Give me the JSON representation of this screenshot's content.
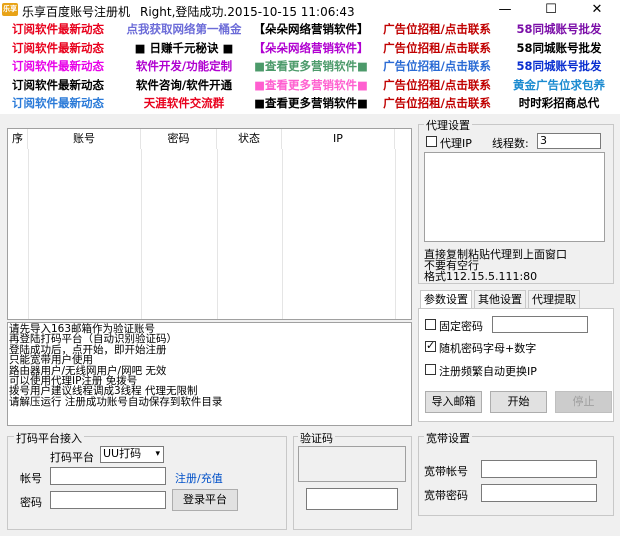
{
  "window": {
    "title": "乐享百度账号注册机",
    "status": "Right,登陆成功.2015-10-15 11:06:43",
    "icon_label": "乐享",
    "minimize": "—",
    "maximize": "☐",
    "close": "✕"
  },
  "ads": [
    {
      "text": "订阅软件最新动态",
      "color": "#e8001c"
    },
    {
      "text": "点我获取网络第一桶金",
      "color": "#6c6cd8"
    },
    {
      "text": "【朵朵网络营销软件】",
      "color": "#000000"
    },
    {
      "text": "广告位招租/点击联系",
      "color": "#c00000"
    },
    {
      "text": "58同城账号批发",
      "color": "#7b0fa8"
    },
    {
      "text": "订阅软件最新动态",
      "color": "#e8001c"
    },
    {
      "text": "■ 日赚千元秘诀 ■",
      "color": "#000000"
    },
    {
      "text": "【朵朵网络营销软件】",
      "color": "#b000d0"
    },
    {
      "text": "广告位招租/点击联系",
      "color": "#c00000"
    },
    {
      "text": "58同城账号批发",
      "color": "#000000"
    },
    {
      "text": "订阅软件最新动态",
      "color": "#e800e8"
    },
    {
      "text": "软件开发/功能定制",
      "color": "#b000d0"
    },
    {
      "text": "■查看更多营销软件■",
      "color": "#4c9a6a"
    },
    {
      "text": "广告位招租/点击联系",
      "color": "#2a6ad4"
    },
    {
      "text": "58同城账号批发",
      "color": "#0a2fd0"
    },
    {
      "text": "订阅软件最新动态",
      "color": "#000000"
    },
    {
      "text": "软件咨询/软件开通",
      "color": "#000000"
    },
    {
      "text": "■查看更多营销软件■",
      "color": "#ff5fd0"
    },
    {
      "text": "广告位招租/点击联系",
      "color": "#c00000"
    },
    {
      "text": "黄金广告位求包养",
      "color": "#1a8ad0"
    },
    {
      "text": "订阅软件最新动态",
      "color": "#2a7ad8"
    },
    {
      "text": "天涯软件交流群",
      "color": "#e8001c"
    },
    {
      "text": "■查看更多营销软件■",
      "color": "#000000"
    },
    {
      "text": "广告位招租/点击联系",
      "color": "#c00000"
    },
    {
      "text": "时时彩招商总代",
      "color": "#000000"
    }
  ],
  "table": {
    "headers": [
      "序",
      "账号",
      "密码",
      "状态",
      "IP"
    ]
  },
  "log_lines": [
    "请先导入163邮箱作为验证账号",
    "再登陆打码平台（自动识别验证码）",
    "登陆成功后，点开始，即开始注册",
    "只能宽带用户使用",
    "路由器用户/无线网用户/网吧 无效",
    "可以使用代理IP注册 免拨号",
    "拨号用户建议线程调成3线程 代理无限制",
    "请解压运行 注册成功账号自动保存到软件目录"
  ],
  "proxy": {
    "group_label": "代理设置",
    "use_proxy_label": "代理IP",
    "use_proxy_checked": false,
    "threads_label": "线程数:",
    "threads_value": "3",
    "hint1": "直接复制粘贴代理到上面窗口",
    "hint2": "不要有空行",
    "hint3": "格式112.15.5.111:80"
  },
  "tabs": [
    "参数设置",
    "其他设置",
    "代理提取"
  ],
  "params": {
    "fixed_pwd_label": "固定密码",
    "fixed_pwd_checked": false,
    "random_pwd_label": "随机密码字母+数字",
    "random_pwd_checked": true,
    "auto_change_ip_label": "注册频繁自动更换IP",
    "auto_change_ip_checked": false,
    "import_btn": "导入邮箱",
    "start_btn": "开始",
    "stop_btn": "停止"
  },
  "captcha_platform": {
    "group_label": "打码平台接入",
    "platform_label": "打码平台",
    "platform_value": "UU打码",
    "account_label": "帐号",
    "password_label": "密码",
    "register_link": "注册/充值",
    "login_btn": "登录平台"
  },
  "captcha": {
    "group_label": "验证码"
  },
  "broadband": {
    "group_label": "宽带设置",
    "account_label": "宽带帐号",
    "password_label": "宽带密码"
  }
}
